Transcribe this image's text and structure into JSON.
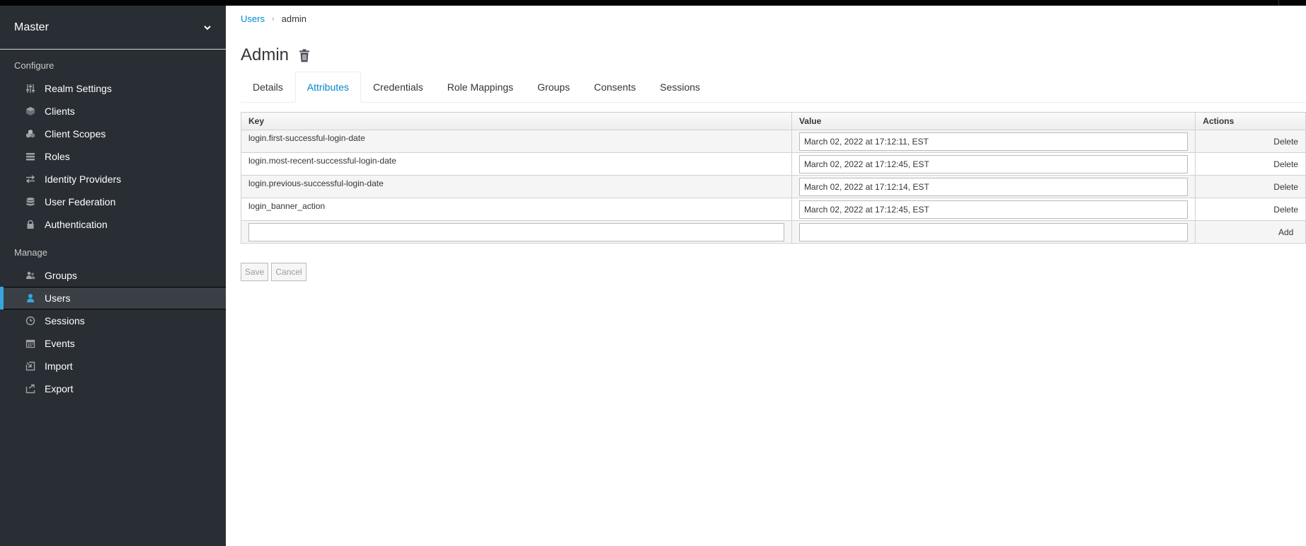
{
  "sidebar": {
    "realm": "Master",
    "configure_title": "Configure",
    "configure_items": [
      {
        "label": "Realm Settings",
        "icon": "sliders-icon"
      },
      {
        "label": "Clients",
        "icon": "cube-icon"
      },
      {
        "label": "Client Scopes",
        "icon": "cubes-icon"
      },
      {
        "label": "Roles",
        "icon": "list-icon"
      },
      {
        "label": "Identity Providers",
        "icon": "exchange-icon"
      },
      {
        "label": "User Federation",
        "icon": "database-icon"
      },
      {
        "label": "Authentication",
        "icon": "lock-icon"
      }
    ],
    "manage_title": "Manage",
    "manage_items": [
      {
        "label": "Groups",
        "icon": "users-icon"
      },
      {
        "label": "Users",
        "icon": "user-icon",
        "active": true
      },
      {
        "label": "Sessions",
        "icon": "clock-icon"
      },
      {
        "label": "Events",
        "icon": "calendar-icon"
      },
      {
        "label": "Import",
        "icon": "import-icon"
      },
      {
        "label": "Export",
        "icon": "export-icon"
      }
    ]
  },
  "breadcrumb": {
    "parent": "Users",
    "current": "admin"
  },
  "page_title": "Admin",
  "tabs": [
    "Details",
    "Attributes",
    "Credentials",
    "Role Mappings",
    "Groups",
    "Consents",
    "Sessions"
  ],
  "active_tab": "Attributes",
  "table": {
    "headers": {
      "key": "Key",
      "value": "Value",
      "actions": "Actions"
    },
    "rows": [
      {
        "key": "login.first-successful-login-date",
        "value": "March 02, 2022 at 17:12:11, EST",
        "action": "Delete"
      },
      {
        "key": "login.most-recent-successful-login-date",
        "value": "March 02, 2022 at 17:12:45, EST",
        "action": "Delete"
      },
      {
        "key": "login.previous-successful-login-date",
        "value": "March 02, 2022 at 17:12:14, EST",
        "action": "Delete"
      },
      {
        "key": "login_banner_action",
        "value": "March 02, 2022 at 17:12:45, EST",
        "action": "Delete"
      }
    ],
    "new_row": {
      "key": "",
      "value": "",
      "action": "Add"
    }
  },
  "buttons": {
    "save": "Save",
    "cancel": "Cancel"
  },
  "colors": {
    "sidebar_bg": "#292e34",
    "accent": "#39a5dc",
    "link": "#0088ce"
  }
}
